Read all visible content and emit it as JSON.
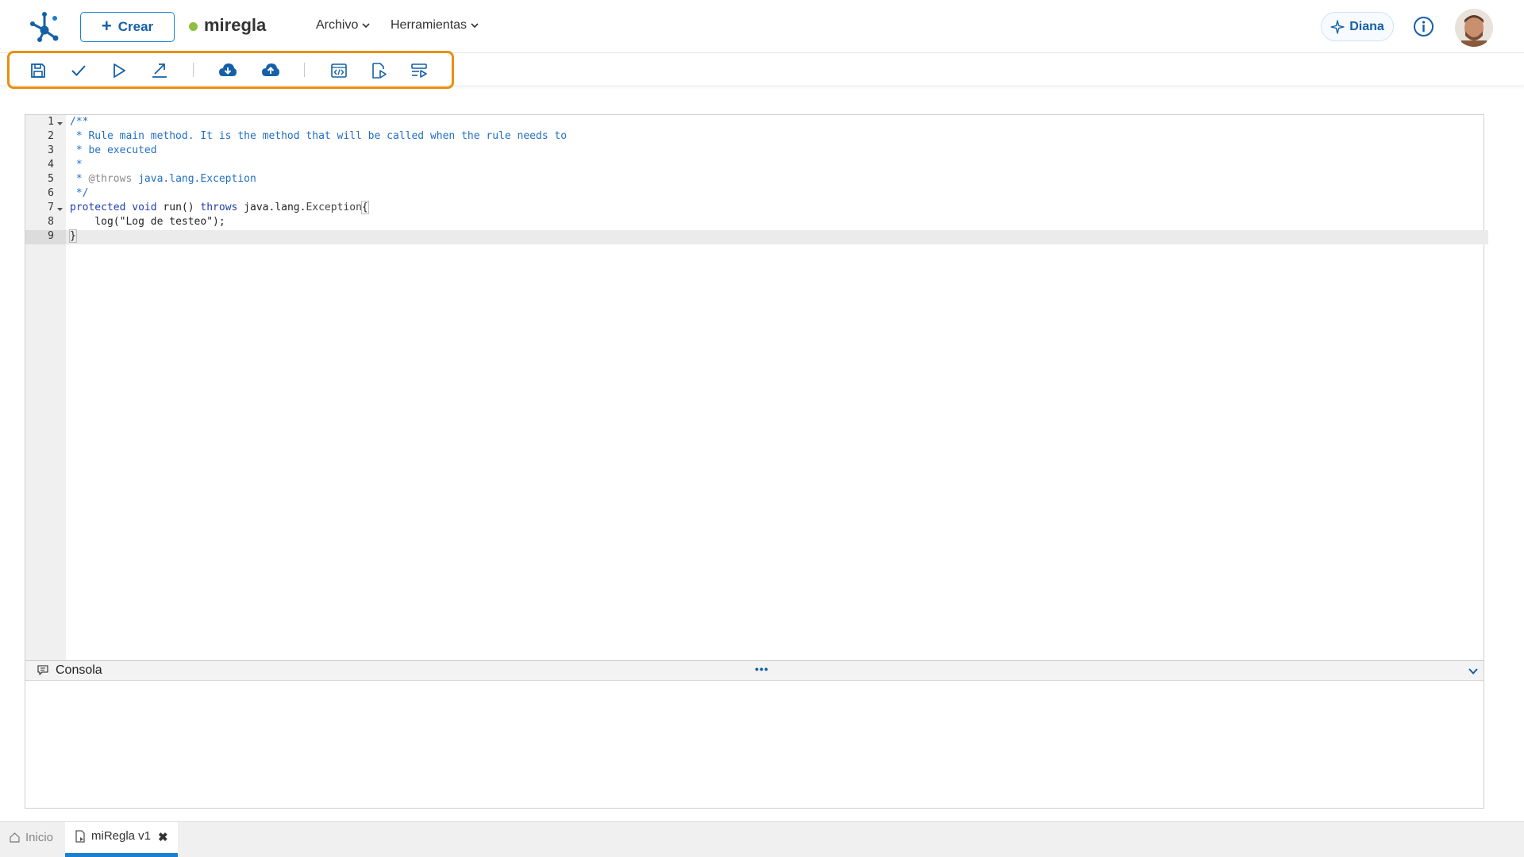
{
  "header": {
    "create_label": "Crear",
    "document_title": "miregla",
    "menus": [
      {
        "label": "Archivo"
      },
      {
        "label": "Herramientas"
      }
    ],
    "assistant_label": "Diana"
  },
  "toolbar": {
    "buttons": [
      "save-icon",
      "validate-check-icon",
      "run-play-icon",
      "export-arrow-icon",
      "cloud-download-icon",
      "cloud-upload-icon",
      "code-view-icon",
      "document-run-icon",
      "list-run-icon"
    ]
  },
  "editor": {
    "line_numbers": [
      "1",
      "2",
      "3",
      "4",
      "5",
      "6",
      "7",
      "8",
      "9"
    ],
    "lines": {
      "l1": "/**",
      "l2": " * Rule main method. It is the method that will be called when the rule needs to",
      "l3": " * be executed",
      "l4": " *",
      "l5_prefix": " * ",
      "l5_tag": "@throws",
      "l5_rest": " java.lang.Exception",
      "l6": " */",
      "l7_kw1": "protected",
      "l7_kw2": "void",
      "l7_mid": " run() ",
      "l7_kw3": "throws",
      "l7_pkg": " java.lang.",
      "l7_cls": "Exception",
      "l7_brace": "{",
      "l8_pre": "    log(",
      "l8_str": "\"Log de testeo\"",
      "l8_post": ");",
      "l9": "}"
    }
  },
  "console": {
    "title": "Consola",
    "dots": "•••"
  },
  "tabs": {
    "home_label": "Inicio",
    "active_label": "miRegla v1",
    "close_symbol": "✖"
  },
  "colors": {
    "accent": "#1b7fd1",
    "highlight": "#e8900c",
    "status_dot": "#8fbf3f"
  }
}
